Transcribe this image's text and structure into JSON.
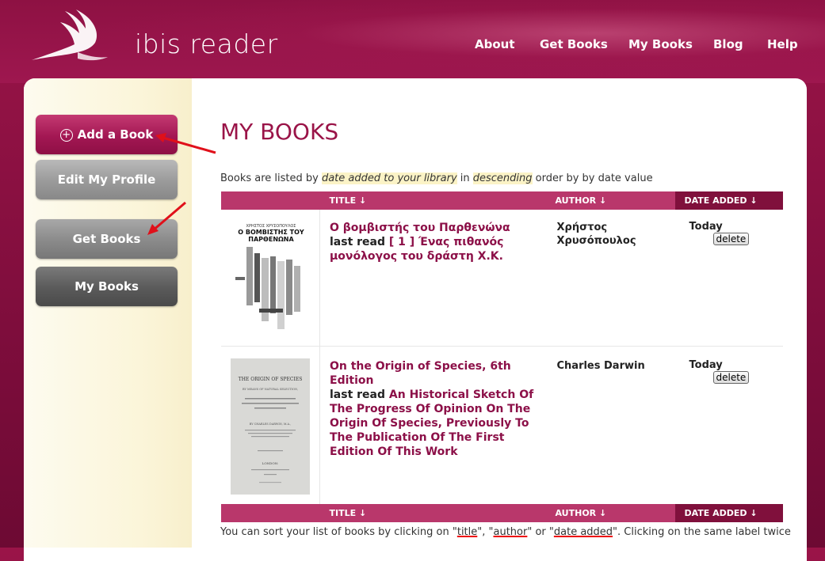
{
  "brand": {
    "name": "ibis reader"
  },
  "topnav": [
    {
      "label": "About"
    },
    {
      "label": "Get Books"
    },
    {
      "label": "My Books"
    },
    {
      "label": "Blog"
    },
    {
      "label": "Help"
    }
  ],
  "sidebar": {
    "add_book": "Add a Book",
    "edit_profile": "Edit My Profile",
    "get_books": "Get Books",
    "my_books": "My Books"
  },
  "main": {
    "title": "MY BOOKS",
    "listed_prefix": "Books are listed by ",
    "listed_field": "date added to your library",
    "listed_mid": " in ",
    "listed_order": "descending",
    "listed_suffix": " order by by date value",
    "columns": {
      "title": "TITLE ↓",
      "author": "AUTHOR ↓",
      "date": "DATE ADDED ↓"
    },
    "books": [
      {
        "title": "Ο βομβιστής του Παρθενώνα",
        "last_read_label": "last read",
        "last_read": "[ 1 ] Ένας πιθανός μονόλογος του δράστη Χ.Κ.",
        "author": "Χρήστος Χρυσόπουλος",
        "date": "Today",
        "delete": "delete",
        "cover_top": "ΧΡΗΣΤΟΣ ΧΡΥΣΟΠΟΥΛΟΣ",
        "cover_title": "Ο ΒΟΜΒΙΣΤΗΣ ΤΟΥ ΠΑΡΘΕΝΩΝΑ"
      },
      {
        "title": "On the Origin of Species, 6th Edition",
        "last_read_label": "last read",
        "last_read": "An Historical Sketch Of The Progress Of Opinion On The Origin Of Species, Previously To The Publication Of The First Edition Of This Work",
        "author": "Charles Darwin",
        "date": "Today",
        "delete": "delete",
        "cover_title": "THE ORIGIN OF SPECIES",
        "cover_sub": "BY MEANS OF NATURAL SELECTION,",
        "cover_author": "BY CHARLES DARWIN, M.A.,",
        "cover_place": "LONDON:"
      }
    ],
    "note_prefix": "You can sort your list of books by clicking on \"",
    "note_title": "title",
    "note_sep1": "\", \"",
    "note_author": "author",
    "note_sep2": "\" or \"",
    "note_date": "date added",
    "note_suffix": "\". Clicking on the same label twice"
  },
  "colors": {
    "brand": "#9a1448",
    "active_header": "#80103c",
    "header_bg": "#b9376b"
  }
}
